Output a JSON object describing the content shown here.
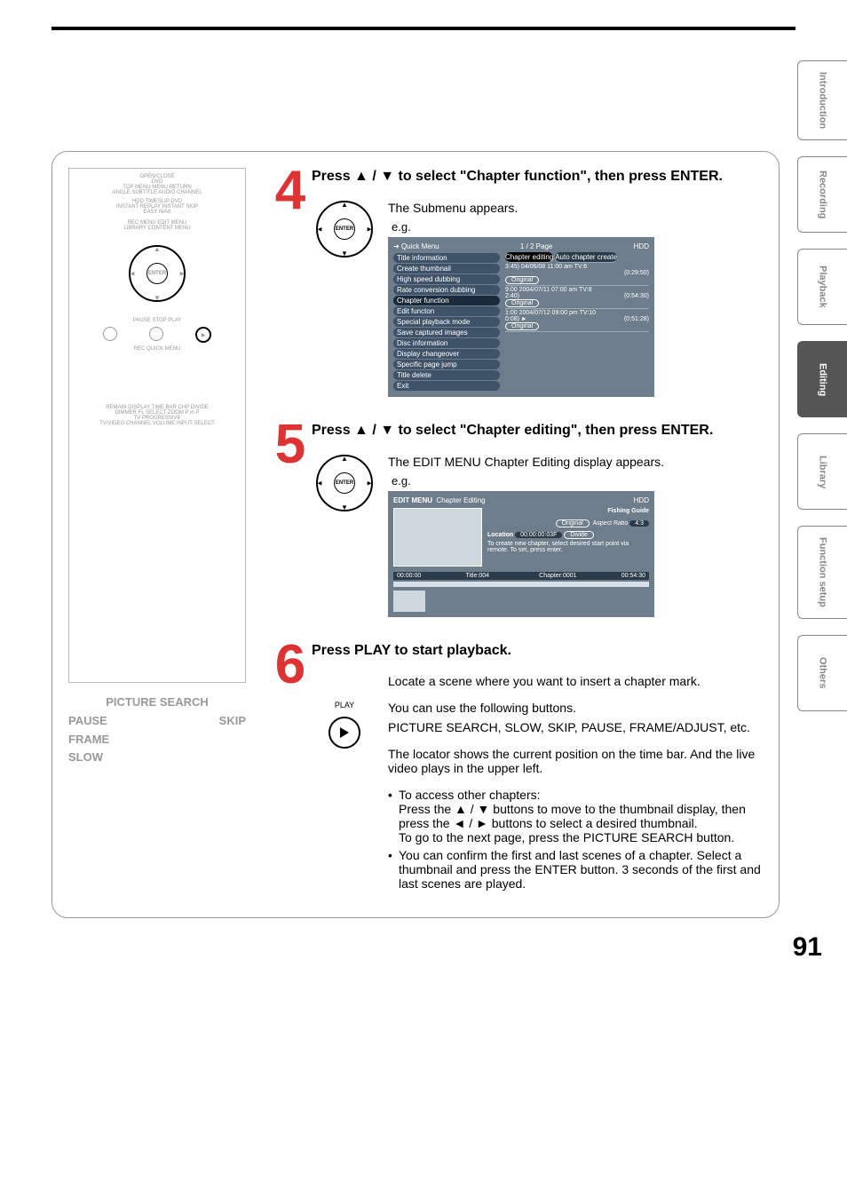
{
  "sidebar": {
    "tabs": [
      "Introduction",
      "Recording",
      "Playback",
      "Editing",
      "Library",
      "Function setup",
      "Others"
    ],
    "active_index": 3
  },
  "page_number": "91",
  "remote_labels": {
    "picture_search": "PICTURE SEARCH",
    "pause": "PAUSE",
    "skip": "SKIP",
    "frame": "FRAME",
    "slow": "SLOW"
  },
  "remote_buttons": {
    "row1": "OPEN/CLOSE",
    "dvd": "DVD",
    "row2": "TOP MENU   MENU   RETURN",
    "row3": "ANGLE   SUBTITLE   AUDIO   CHANNEL",
    "row4": "HDD   TIMESLIP   DVD",
    "row4b": "INSTANT REPLAY  INSTANT SKIP",
    "easy": "EASY NAVI",
    "row5": "REC MENU  EDIT MENU",
    "row5b": "LIBRARY            CONTENT MENU",
    "slow": "SLOW",
    "skip": "SKIP",
    "enter": "ENTER",
    "frame": "FRAME/ADJUST",
    "picsearch": "PICTURE SEARCH",
    "row6": "PAUSE   STOP   PLAY",
    "row7": "REC               QUICK MENU",
    "row8": "REMAIN  DISPLAY  TIME BAR  CHP DIVIDE",
    "row9": "DIMMER  FL SELECT  ZOOM  P in P",
    "row9b": "TV              PROGRESSIVE",
    "row10": "TV/VIDEO  CHANNEL  VOLUME  INPUT SELECT"
  },
  "steps": {
    "s4": {
      "num": "4",
      "heading": "Press ▲ / ▼ to select \"Chapter function\", then press ENTER.",
      "desc": "The Submenu appears.",
      "eg": "e.g.",
      "screen": {
        "quick_menu_label": "Quick Menu",
        "page": "1 / 2  Page",
        "hdd": "HDD",
        "menu_items": [
          "Title information",
          "Create thumbnail",
          "High speed dubbing",
          "Rate conversion dubbing",
          "Chapter function",
          "Edit functon",
          "Special playback mode",
          "Save captured images",
          "Disc information",
          "Display changeover",
          "Specific page jump",
          "Title delete",
          "Exit"
        ],
        "right_header": "Chapter editing",
        "right_sub": "Auto chapter create",
        "entries": [
          {
            "date": "04/06/08 11:00",
            "ch": "am  TV:6",
            "dur": "(0:29:50)",
            "tag": "Original",
            "time": "3:45)"
          },
          {
            "date": "2004/07/11 07:00",
            "ch": "am  TV:8",
            "dur": "(0:54:30)",
            "tag": "Original",
            "time": "2:40)",
            "left": "9:00"
          },
          {
            "date": "2004/07/12 09:00",
            "ch": "pm  TV:10",
            "dur": "(0:51:28)",
            "tag": "Original",
            "time": "0:08)",
            "left": "1:00"
          }
        ]
      }
    },
    "s5": {
      "num": "5",
      "heading": "Press ▲ / ▼ to select \"Chapter editing\", then press ENTER.",
      "desc": "The EDIT MENU Chapter Editing display appears.",
      "eg": "e.g.",
      "screen": {
        "title": "EDIT MENU",
        "subtitle": "Chapter Editing",
        "hdd": "HDD",
        "program": "Fishing Guide",
        "original": "Original",
        "aspect_label": "Aspect Ratio",
        "aspect_val": "4:3",
        "location_label": "Location",
        "location_val": "00:00:00:03F",
        "divide": "Divide",
        "instruction": "To create new chapter, select desired start point via remote. To set, press enter.",
        "timebar_left": "00:00:00",
        "title_no": "Title:004",
        "chapter_no": "Chapter:0001",
        "timebar_right": "00:54:30"
      }
    },
    "s6": {
      "num": "6",
      "heading": "Press PLAY to start playback.",
      "play_label": "PLAY",
      "p1": "Locate a scene where you want to insert a chapter mark.",
      "p2": "You can use the following buttons.",
      "p3": "PICTURE SEARCH, SLOW, SKIP, PAUSE, FRAME/ADJUST, etc.",
      "p4": "The locator shows the current position on the time bar. And the live video plays in the upper left.",
      "b1": "To access other chapters:",
      "b1a": "Press the ▲ / ▼ buttons to move to the thumbnail display, then press the ◄ / ► buttons to select a desired thumbnail.",
      "b1b": "To go to the next page, press the PICTURE SEARCH button.",
      "b2": "You can confirm the first and last scenes of a chapter. Select a thumbnail and press the ENTER button. 3 seconds of the first and last scenes are played."
    }
  }
}
